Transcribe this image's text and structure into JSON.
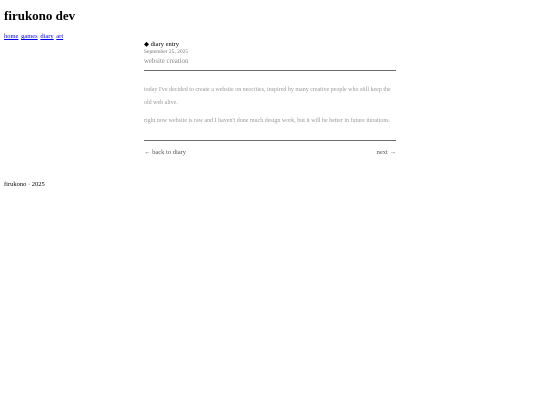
{
  "site": {
    "title": "firukono dev"
  },
  "nav": {
    "items": [
      {
        "label": "home"
      },
      {
        "label": "games"
      },
      {
        "label": "diary"
      },
      {
        "label": "art"
      }
    ]
  },
  "entry": {
    "kind": "◆ diary entry",
    "date": "September 25, 2025",
    "title": "website creation",
    "paragraphs": [
      "today I've decided to create a website on neocities, inspired by many creative people who still keep the old web alive.",
      "right now website is raw and I haven't done much design work, but it will be better in future iterations."
    ]
  },
  "pager": {
    "back_label": "← back to diary",
    "next_label": "next →"
  },
  "footer": {
    "text": "firukono · 2025"
  },
  "colors": {
    "link": "#0000ee",
    "muted_text": "#9a9a9a",
    "rule": "#6b6b6b"
  }
}
